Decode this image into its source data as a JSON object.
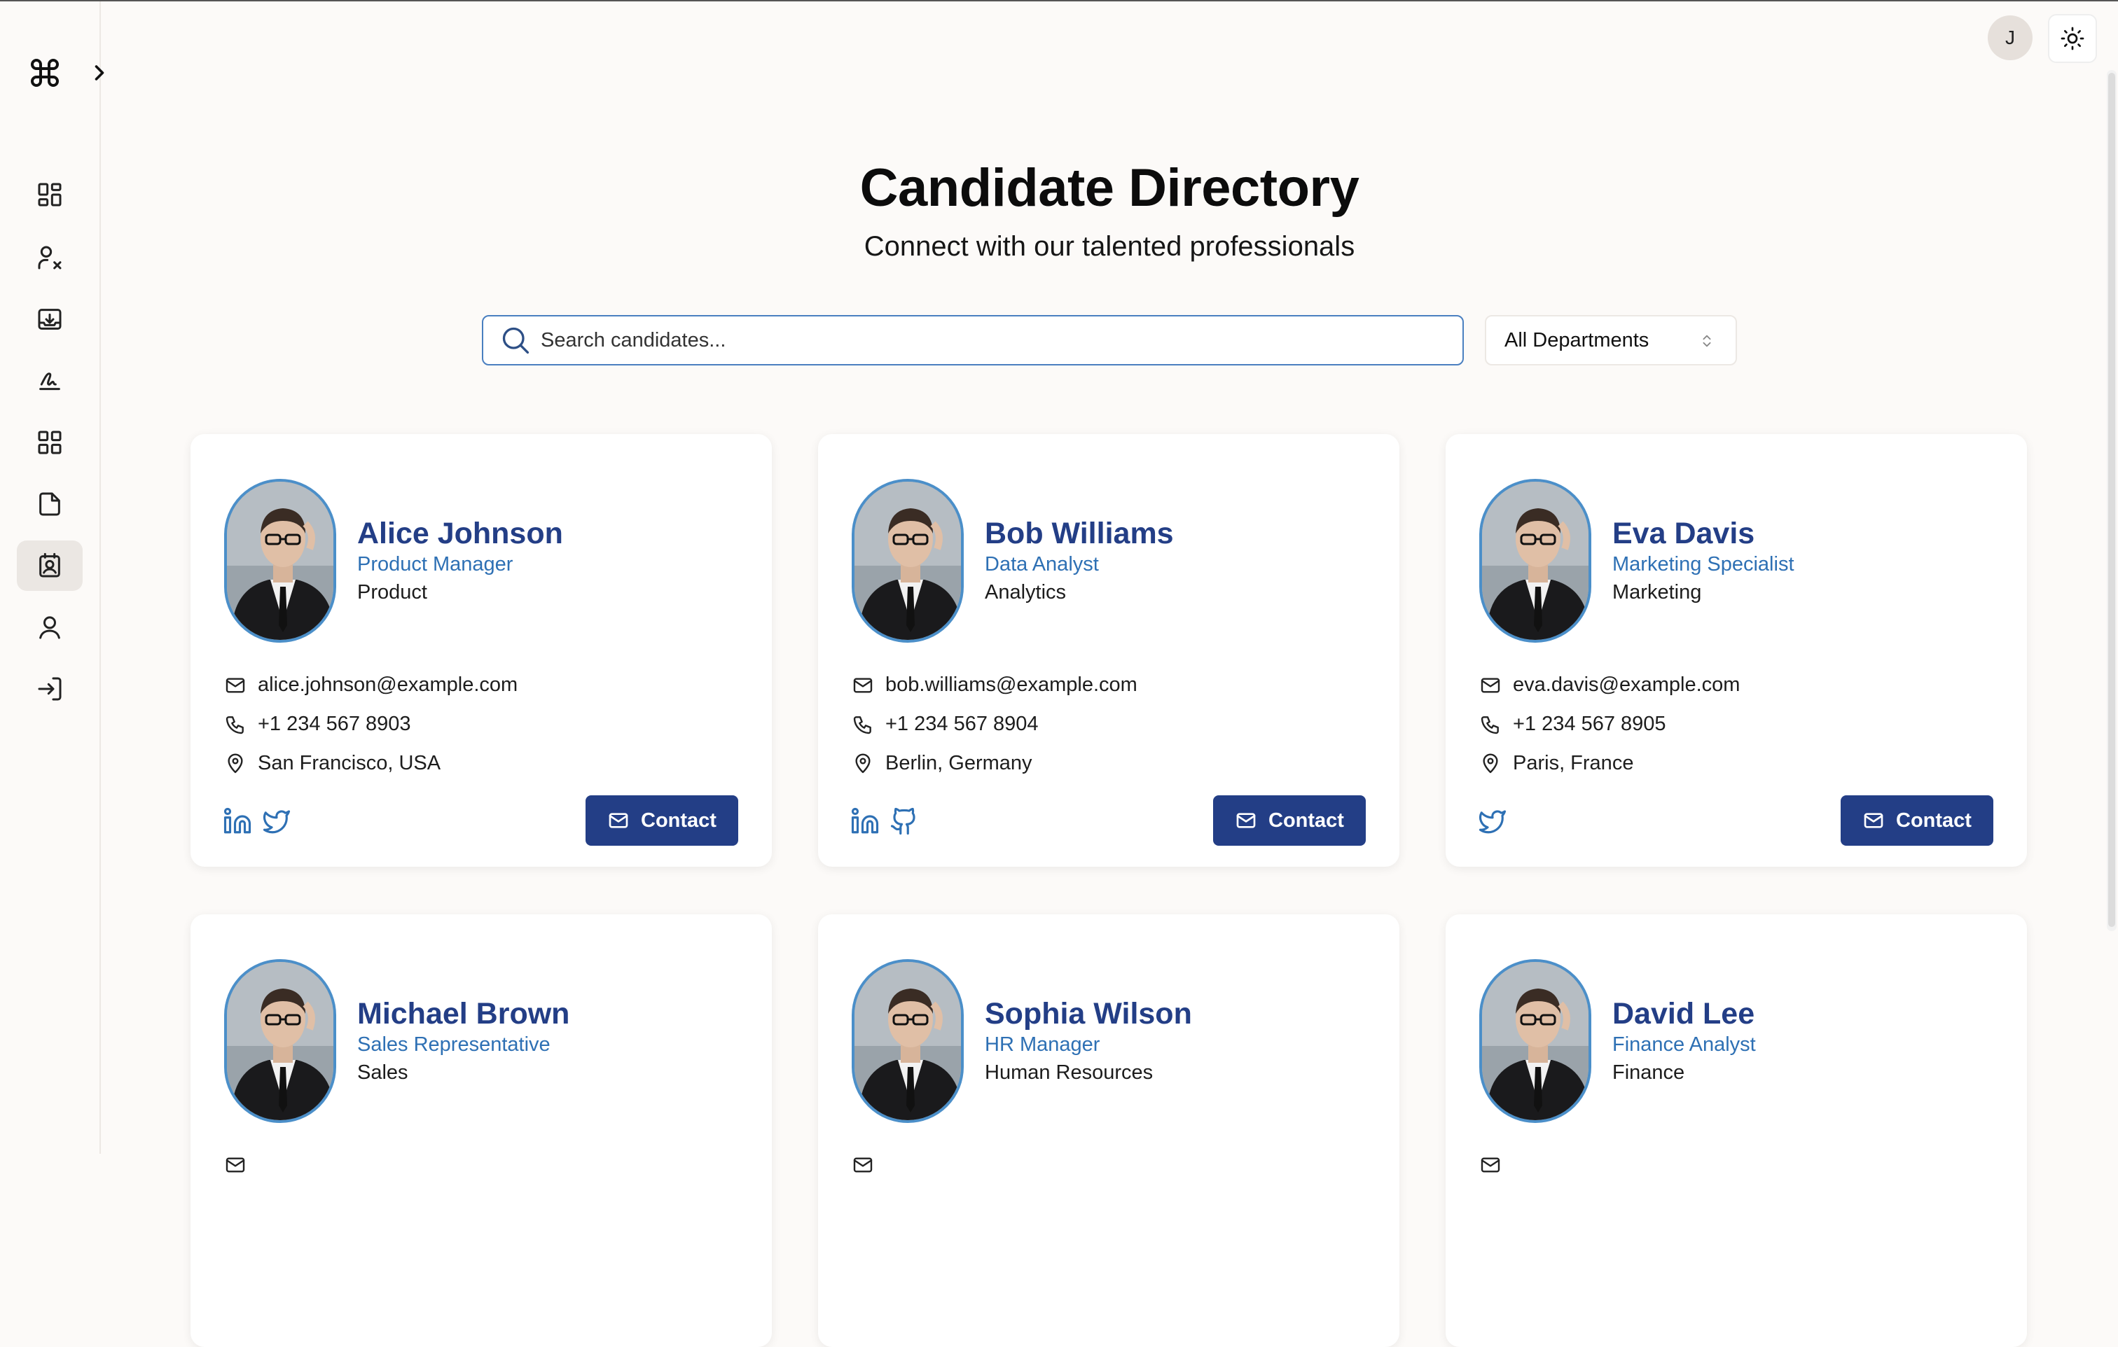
{
  "user": {
    "initial": "J"
  },
  "header": {
    "title": "Candidate Directory",
    "subtitle": "Connect with our talented professionals"
  },
  "search": {
    "placeholder": "Search candidates...",
    "value": ""
  },
  "filter": {
    "selected": "All Departments"
  },
  "colors": {
    "accent": "#233e86",
    "role": "#2e70b4",
    "photo_border": "#4b8fc9"
  },
  "sidebar": {
    "items": [
      {
        "icon": "dashboard-icon"
      },
      {
        "icon": "user-x-icon"
      },
      {
        "icon": "inbox-download-icon"
      },
      {
        "icon": "signature-icon"
      },
      {
        "icon": "grid-icon"
      },
      {
        "icon": "file-icon"
      },
      {
        "icon": "contact-card-icon",
        "active": true
      },
      {
        "icon": "user-icon"
      },
      {
        "icon": "login-icon"
      }
    ]
  },
  "contact_label": "Contact",
  "candidates": [
    {
      "name": "Alice Johnson",
      "role": "Product Manager",
      "department": "Product",
      "email": "alice.johnson@example.com",
      "phone": "+1 234 567 8903",
      "location": "San Francisco, USA",
      "social": [
        "linkedin-icon",
        "twitter-icon"
      ]
    },
    {
      "name": "Bob Williams",
      "role": "Data Analyst",
      "department": "Analytics",
      "email": "bob.williams@example.com",
      "phone": "+1 234 567 8904",
      "location": "Berlin, Germany",
      "social": [
        "linkedin-icon",
        "github-icon"
      ]
    },
    {
      "name": "Eva Davis",
      "role": "Marketing Specialist",
      "department": "Marketing",
      "email": "eva.davis@example.com",
      "phone": "+1 234 567 8905",
      "location": "Paris, France",
      "social": [
        "twitter-icon"
      ]
    },
    {
      "name": "Michael Brown",
      "role": "Sales Representative",
      "department": "Sales"
    },
    {
      "name": "Sophia Wilson",
      "role": "HR Manager",
      "department": "Human Resources"
    },
    {
      "name": "David Lee",
      "role": "Finance Analyst",
      "department": "Finance"
    }
  ]
}
